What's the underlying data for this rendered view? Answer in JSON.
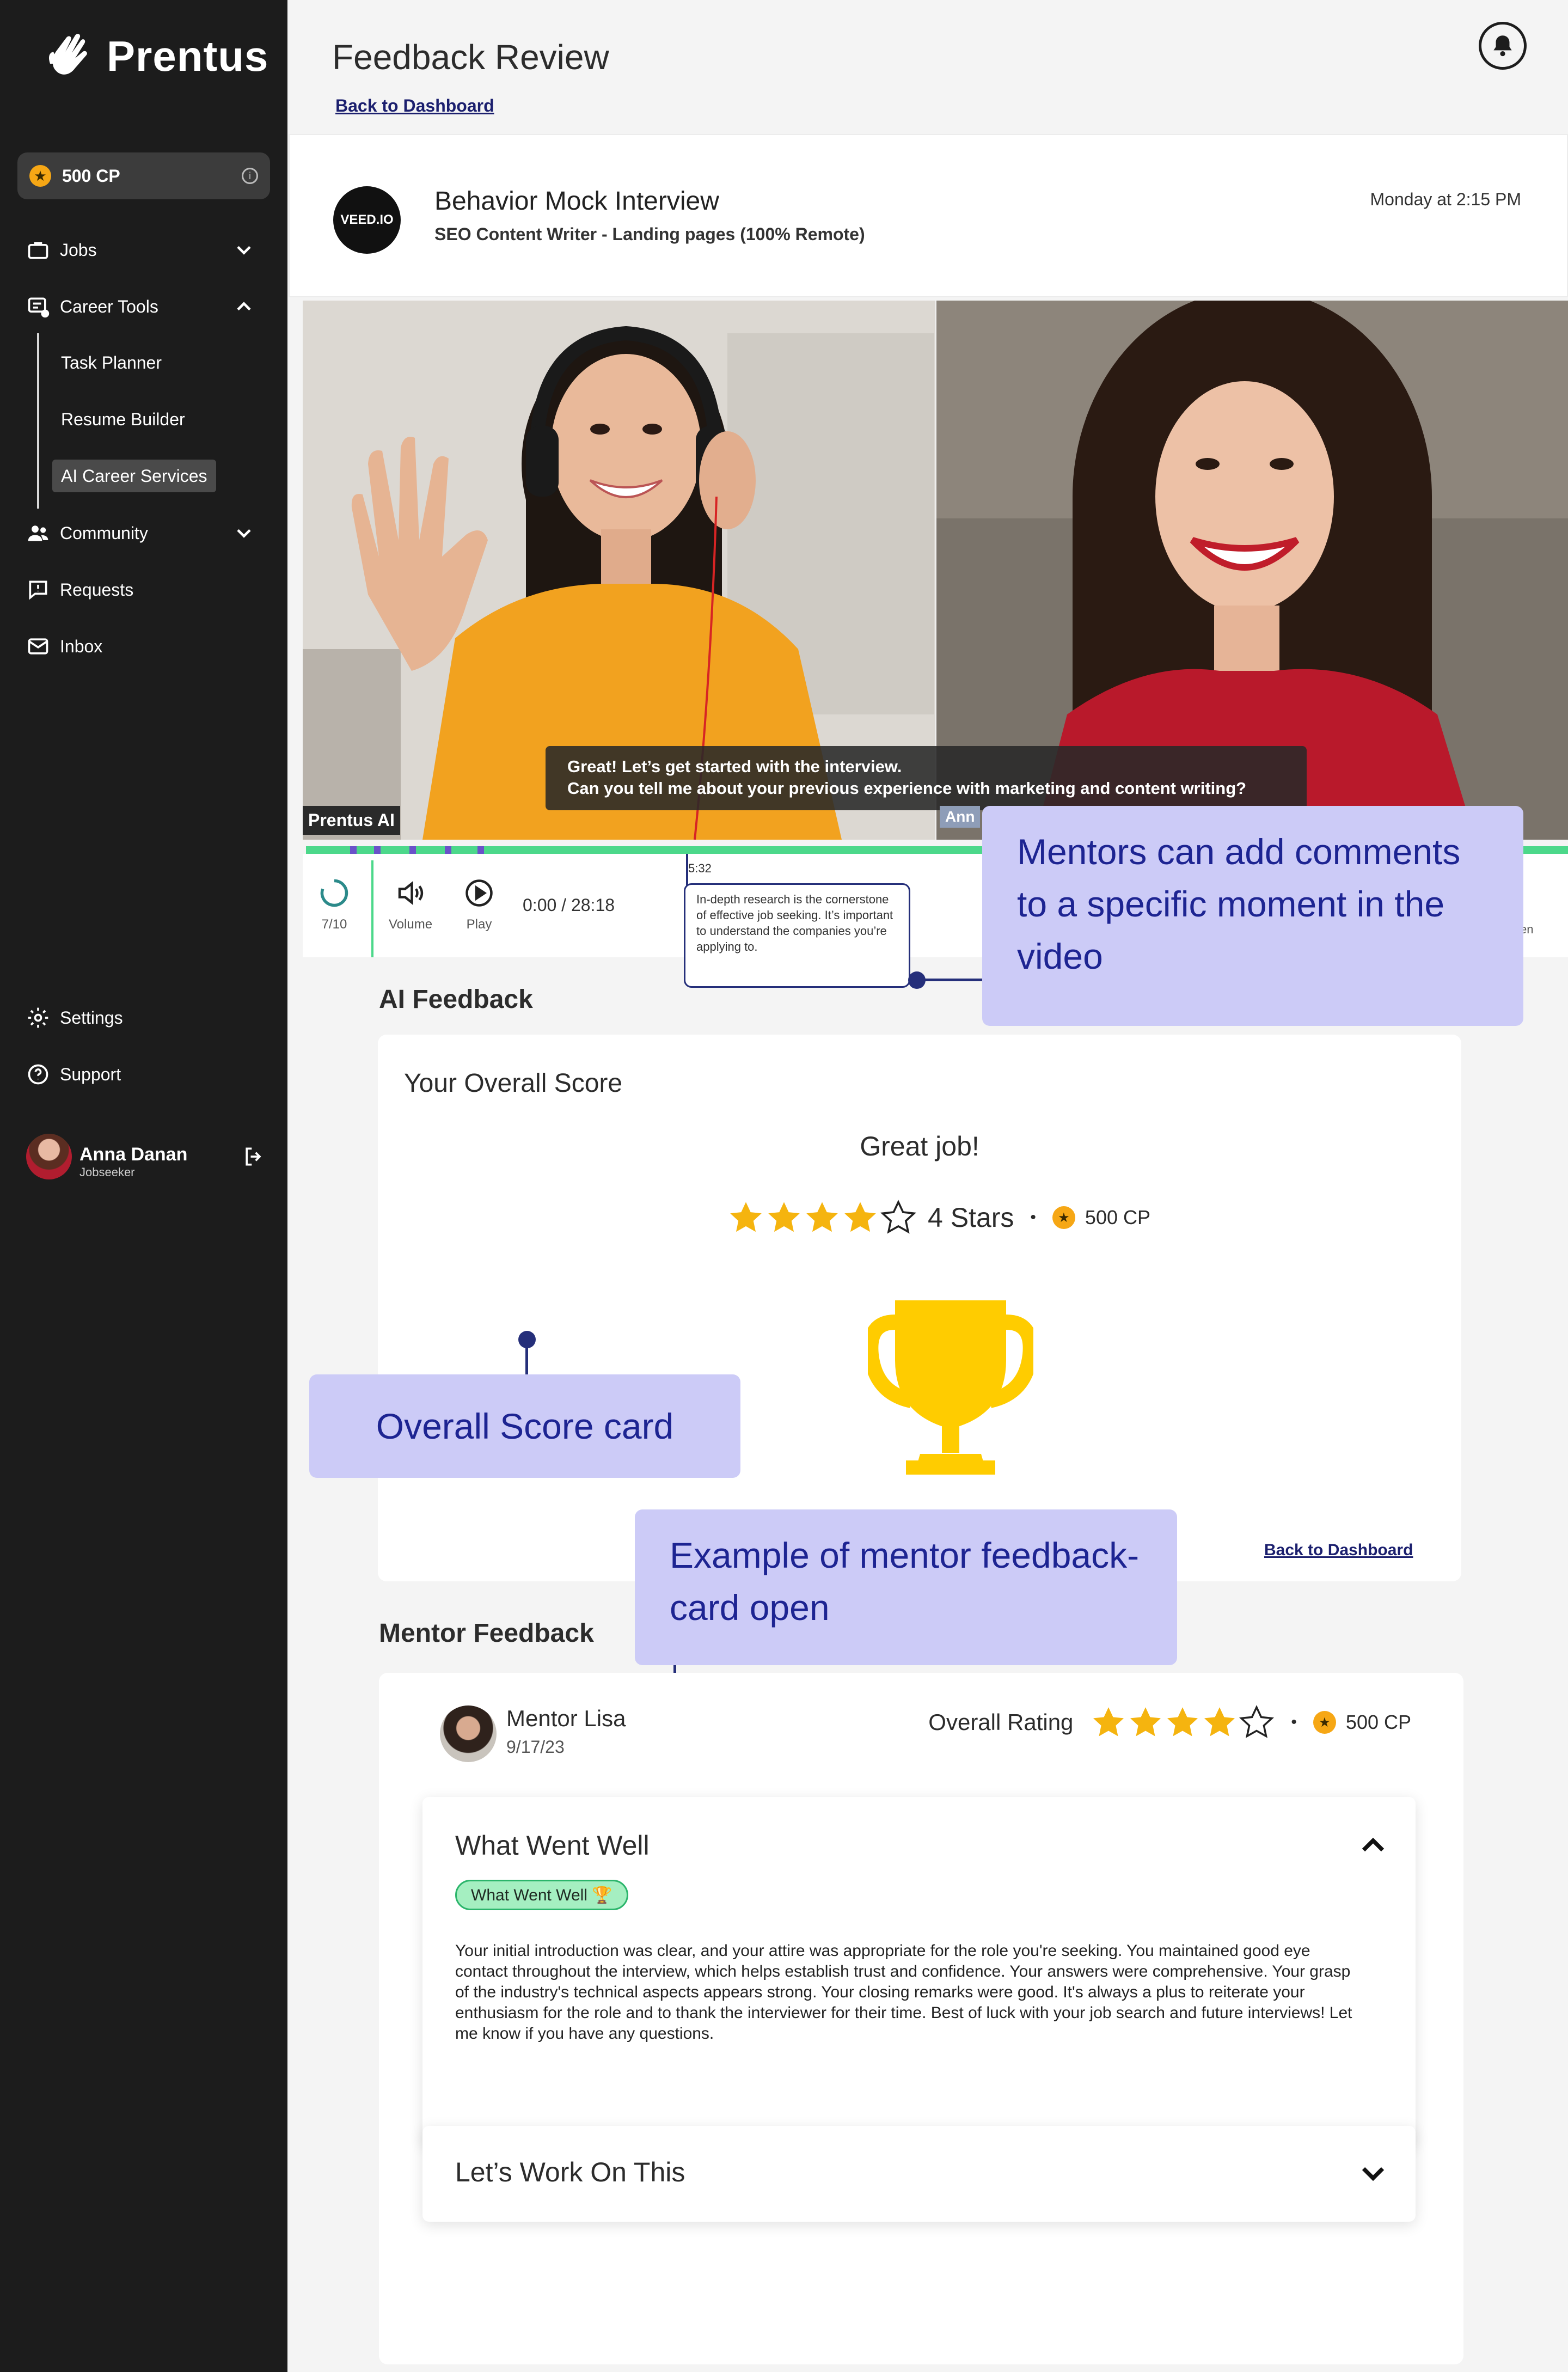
{
  "brand": {
    "name": "Prentus"
  },
  "sidebar": {
    "cp_balance": "500 CP",
    "items": [
      {
        "label": "Jobs",
        "icon": "briefcase-icon",
        "chevron": "down"
      },
      {
        "label": "Career Tools",
        "icon": "career-tools-icon",
        "chevron": "up"
      },
      {
        "label": "Community",
        "icon": "community-icon",
        "chevron": "down"
      },
      {
        "label": "Requests",
        "icon": "requests-icon"
      },
      {
        "label": "Inbox",
        "icon": "inbox-icon"
      }
    ],
    "sub_items": [
      "Task Planner",
      "Resume Builder",
      "AI Career Services"
    ],
    "active_sub_item": "AI Career Services",
    "bottom_items": [
      {
        "label": "Settings",
        "icon": "gear-icon"
      },
      {
        "label": "Support",
        "icon": "help-icon"
      }
    ],
    "user": {
      "name": "Anna Danan",
      "role": "Jobseeker"
    }
  },
  "header": {
    "title": "Feedback Review",
    "back_link": "Back to Dashboard"
  },
  "interview": {
    "company_logo_text": "VEED.IO",
    "title": "Behavior Mock Interview",
    "subtitle": "SEO Content Writer - Landing pages (100% Remote)",
    "date": "Monday at 2:15 PM"
  },
  "video": {
    "left_label": "Prentus AI",
    "right_label": "Ann",
    "caption_line1": "Great! Let’s get started with the interview.",
    "caption_line2": "Can you tell me about your previous experience with marketing and content writing?",
    "controls": {
      "progress_label": "7/10",
      "volume_label": "Volume",
      "play_label": "Play",
      "current_time": "0:00",
      "total_time": "/ 28:18",
      "right_cutoff": "en"
    },
    "comment": {
      "timestamp": "5:32",
      "text": "In-depth research is the cornerstone of effective job seeking. It’s important to understand the companies you’re applying to."
    },
    "marker_positions_pct": [
      3.5,
      5.4,
      8.2,
      11.0,
      13.6
    ]
  },
  "annotations": {
    "comments_callout": "Mentors can add comments to a specific moment in the video",
    "score_callout": "Overall Score card",
    "mentor_callout": "Example of mentor feedback- card open"
  },
  "ai_feedback": {
    "section_title": "AI Feedback",
    "card_title": "Your Overall Score",
    "headline": "Great job!",
    "rating": 4,
    "max_rating": 5,
    "stars_text": "4 Stars",
    "cp": "500 CP",
    "back_link": "Back to Dashboard"
  },
  "mentor_feedback": {
    "section_title": "Mentor Feedback",
    "mentor_name": "Mentor Lisa",
    "date": "9/17/23",
    "overall_label": "Overall Rating",
    "rating": 4,
    "max_rating": 5,
    "cp": "500 CP",
    "went_well": {
      "title": "What Went Well",
      "tag": "What Went Well 🏆",
      "body": "Your initial introduction was clear, and your attire was appropriate for the role you're seeking. You maintained good eye contact throughout the interview, which helps establish trust and confidence. Your answers were comprehensive. Your grasp of the industry's technical aspects appears strong. Your closing remarks were good. It's always a plus to reiterate your enthusiasm for the role and to thank the interviewer for their time. Best of luck with your job search and future interviews! Let me know if you have any questions."
    },
    "work_on": {
      "title": "Let’s Work On This"
    }
  },
  "colors": {
    "sidebar_bg": "#1c1c1c",
    "accent_green": "#4cd88a",
    "callout_bg": "#cccbf7",
    "callout_text": "#1d2492",
    "star_gold": "#f5b40f",
    "trophy_gold": "#ffcc00",
    "link_navy": "#1b1f6e"
  }
}
